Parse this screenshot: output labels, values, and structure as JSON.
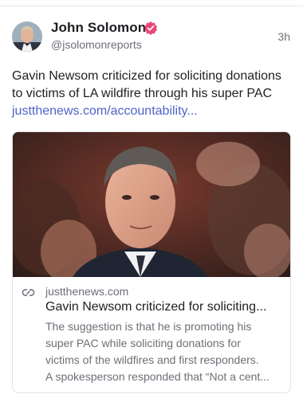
{
  "post": {
    "author": {
      "name": "John Solomon",
      "handle": "@jsolomonreports",
      "verified_color": "#e8477a"
    },
    "timestamp": "3h",
    "text": "Gavin Newsom criticized for soliciting donations to victims of LA wildfire through his super PAC ",
    "link_text": "justthenews.com/accountability...",
    "link_color": "#4f64c8",
    "card": {
      "domain": "justthenews.com",
      "title": "Gavin Newsom criticized for soliciting...",
      "description_lines": [
        "The suggestion is that he is promoting his",
        "super PAC while soliciting donations for",
        "victims of the wildfires and first responders.",
        "A spokesperson responded that “Not a cent..."
      ]
    }
  },
  "icons": {
    "verified": "verified-badge-icon",
    "link": "link-icon"
  }
}
